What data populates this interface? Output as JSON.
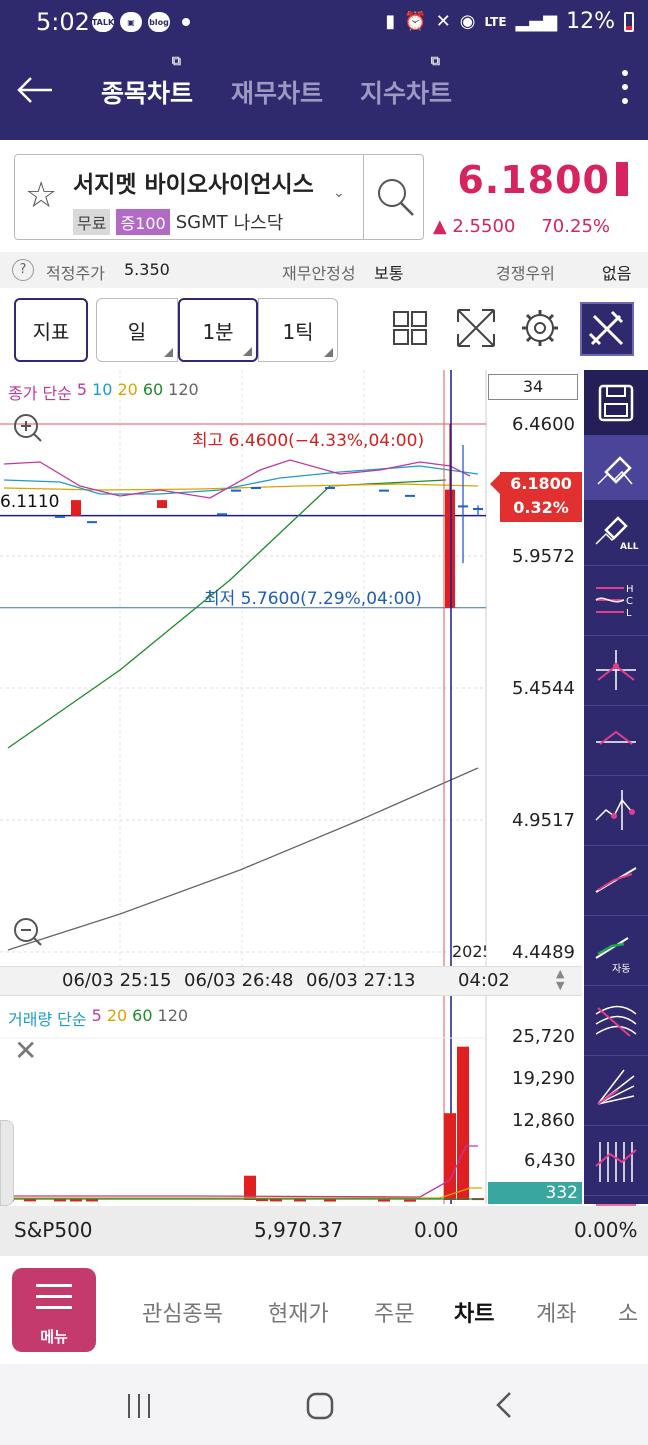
{
  "status_bar": {
    "time": "5:02",
    "left_icons": [
      "talk-icon",
      "gallery-icon",
      "blog-icon"
    ],
    "talk_label": "TALK",
    "blog_label": "blog",
    "battery": "12%",
    "lte": "LTE"
  },
  "app_bar": {
    "tabs": [
      {
        "label": "종목차트",
        "active": true
      },
      {
        "label": "재무차트",
        "active": false
      },
      {
        "label": "지수차트",
        "active": false
      }
    ]
  },
  "stock": {
    "name": "서지멧 바이오사이언시스",
    "tag_free": "무료",
    "tag_margin": "증100",
    "ticker": "SGMT",
    "market": "나스닥",
    "price": "6.1800",
    "change": "▲ 2.5500",
    "change_pct": "70.25%",
    "accent": "#d6245f"
  },
  "info_row": {
    "help": "?",
    "fair_label": "적정주가",
    "fair_value": "5.350",
    "stability_label": "재무안정성",
    "stability_value": "보통",
    "comp_label": "경쟁우위",
    "comp_value": "없음"
  },
  "toolbar": {
    "indicator": "지표",
    "day": "일",
    "minute": "1분",
    "tick": "1틱"
  },
  "chart_data": [
    {
      "type": "candlestick",
      "title": "",
      "legend": [
        "종가",
        "단순",
        "5",
        "10",
        "20",
        "60",
        "120"
      ],
      "legend_colors": [
        "#c0389f",
        "#c0389f",
        "#c0389f",
        "#1f9bc8",
        "#d9a400",
        "#1e8a2a",
        "#666666"
      ],
      "y_ticks": [
        "6.4600",
        "5.9572",
        "5.4544",
        "4.9517",
        "4.4489"
      ],
      "ylim": [
        4.4489,
        6.46
      ],
      "x_ticks": [
        "06/03 25:15",
        "06/03 26:48",
        "06/03 27:13",
        "04:02"
      ],
      "x_cut_label": "2025",
      "count_box": "34",
      "high_label": "최고 6.4600(−4.33%,04:00)",
      "low_label": "최저 5.7600(7.29%,04:00)",
      "crosshair_price": "6.1110",
      "current_price_tag": "6.1800",
      "current_pct_tag": "0.32%",
      "high": 6.46,
      "low": 5.76,
      "crosshair_value": 6.111,
      "current_value": 6.18,
      "candles": [
        {
          "t": 0,
          "o": 6.2,
          "h": 6.2,
          "l": 6.2,
          "c": 6.2
        },
        {
          "t": 1,
          "o": 6.2,
          "h": 6.2,
          "l": 6.2,
          "c": 6.2
        },
        {
          "t": 2,
          "o": 6.11,
          "h": 6.11,
          "l": 6.11,
          "c": 6.11
        },
        {
          "t": 3,
          "o": 6.17,
          "h": 6.17,
          "l": 6.11,
          "c": 6.11
        },
        {
          "t": 4,
          "o": 6.09,
          "h": 6.09,
          "l": 6.09,
          "c": 6.09
        },
        {
          "t": 5,
          "o": 6.14,
          "h": 6.17,
          "l": 6.14,
          "c": 6.17
        },
        {
          "t": 6,
          "o": 6.12,
          "h": 6.12,
          "l": 6.12,
          "c": 6.12
        },
        {
          "t": 7,
          "o": 6.21,
          "h": 6.21,
          "l": 6.21,
          "c": 6.21
        },
        {
          "t": 8,
          "o": 6.22,
          "h": 6.22,
          "l": 6.22,
          "c": 6.22
        },
        {
          "t": 9,
          "o": 6.22,
          "h": 6.22,
          "l": 6.22,
          "c": 6.22
        },
        {
          "t": 10,
          "o": 6.21,
          "h": 6.21,
          "l": 6.21,
          "c": 6.21
        },
        {
          "t": 11,
          "o": 6.19,
          "h": 6.19,
          "l": 6.19,
          "c": 6.19
        },
        {
          "t": 12,
          "o": 6.21,
          "h": 6.46,
          "l": 5.76,
          "c": 5.76
        },
        {
          "t": 13,
          "o": 6.15,
          "h": 6.38,
          "l": 5.93,
          "c": 6.15
        },
        {
          "t": 14,
          "o": 6.14,
          "h": 6.15,
          "l": 6.11,
          "c": 6.14
        }
      ]
    },
    {
      "type": "bar",
      "title": "",
      "legend": [
        "거래량",
        "단순",
        "5",
        "20",
        "60",
        "120"
      ],
      "legend_colors": [
        "#1f9bc8",
        "#1f9bc8",
        "#c0389f",
        "#d9a400",
        "#1e8a2a",
        "#666666"
      ],
      "y_ticks": [
        "25,720",
        "19,290",
        "12,860",
        "6,430"
      ],
      "ylim": [
        0,
        28000
      ],
      "current_volume": "332",
      "values": [
        120,
        110,
        100,
        90,
        95,
        4200,
        150,
        100,
        90,
        80,
        70,
        60,
        15000,
        26500,
        332
      ]
    }
  ],
  "right_tools": [
    "save-icon",
    "eraser-icon",
    "eraser-all-icon",
    "hcl-icon",
    "crosshair-icon",
    "trend-icon",
    "zigzag-icon",
    "line-icon",
    "auto-line-icon",
    "fibonacci-icon",
    "fan-icon",
    "cycle-icon",
    "channel-icon"
  ],
  "right_tools_labels": {
    "all": "ALL",
    "auto": "자동"
  },
  "index_bar": {
    "name": "S&P500",
    "value": "5,970.37",
    "change": "0.00",
    "change_pct": "0.00%"
  },
  "bottom_nav": {
    "menu_label": "메뉴",
    "items": [
      {
        "label": "관심종목",
        "active": false
      },
      {
        "label": "현재가",
        "active": false
      },
      {
        "label": "주문",
        "active": false
      },
      {
        "label": "차트",
        "active": true
      },
      {
        "label": "계좌",
        "active": false
      },
      {
        "label": "소",
        "active": false
      }
    ]
  }
}
